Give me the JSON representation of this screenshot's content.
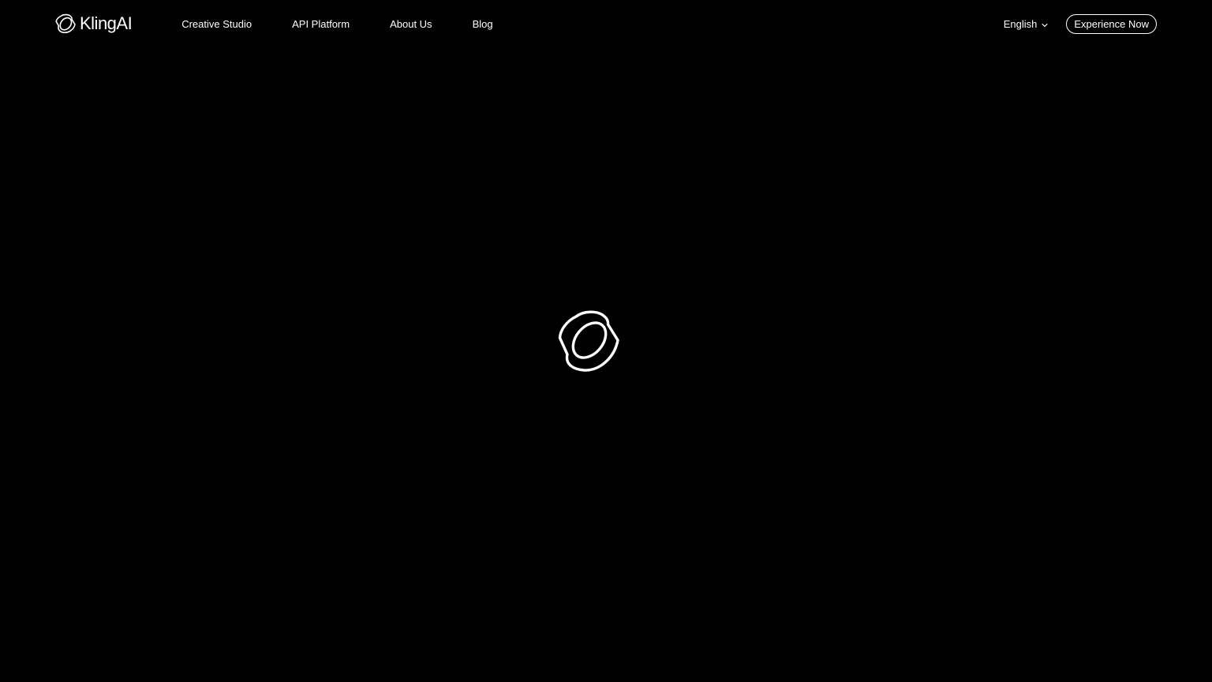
{
  "header": {
    "brand_name": "KlingAI",
    "brand_icon": "kling-logo-icon",
    "nav": [
      {
        "label": "Creative Studio"
      },
      {
        "label": "API Platform"
      },
      {
        "label": "About Us"
      },
      {
        "label": "Blog"
      }
    ],
    "language": {
      "selected": "English",
      "icon": "chevron-down-icon"
    },
    "cta_label": "Experience Now"
  },
  "main": {
    "loader_icon": "kling-logo-icon"
  },
  "colors": {
    "background": "#000000",
    "foreground": "#ffffff"
  }
}
